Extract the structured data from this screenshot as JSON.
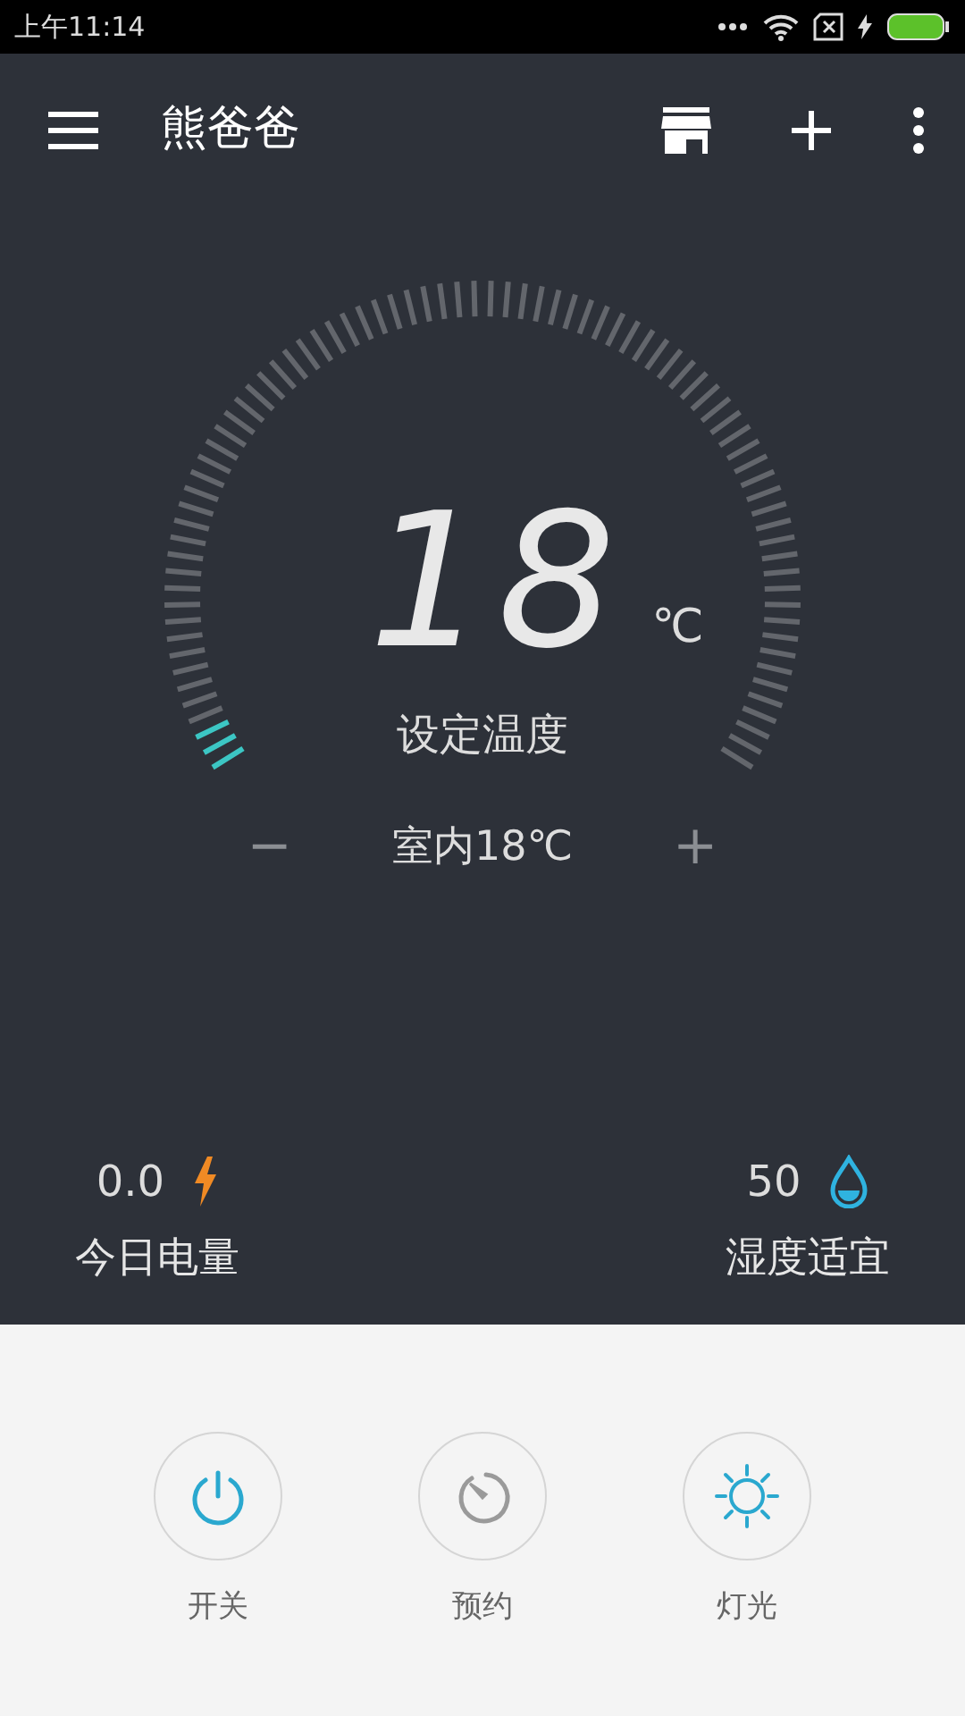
{
  "status_bar": {
    "time": "上午11:14"
  },
  "app_bar": {
    "title": "熊爸爸"
  },
  "dial": {
    "set_temp": "18",
    "unit": "℃",
    "caption": "设定温度",
    "decrease": "−",
    "indoor": "室内18℃",
    "increase": "+"
  },
  "stats": [
    {
      "value": "0.0",
      "label": "今日电量",
      "kind": "power"
    },
    {
      "value": "50",
      "label": "湿度适宜",
      "kind": "humidity"
    }
  ],
  "controls": [
    {
      "label": "开关",
      "kind": "power",
      "active": true
    },
    {
      "label": "预约",
      "kind": "timer",
      "active": false
    },
    {
      "label": "灯光",
      "kind": "light",
      "active": true
    }
  ]
}
